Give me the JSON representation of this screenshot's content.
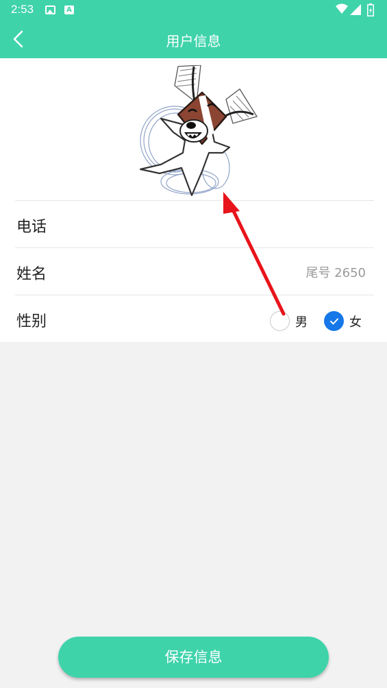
{
  "status_bar": {
    "time": "2:53"
  },
  "header": {
    "title": "用户信息"
  },
  "form": {
    "phone_label": "电话",
    "phone_value": "",
    "name_label": "姓名",
    "name_value": "尾号 2650",
    "gender_label": "性别",
    "gender_options": [
      {
        "label": "男",
        "checked": false
      },
      {
        "label": "女",
        "checked": true
      }
    ]
  },
  "save_button": {
    "label": "保存信息"
  },
  "colors": {
    "accent": "#3fd3aa",
    "check": "#1677e8",
    "annotation_arrow": "#e8141b"
  }
}
